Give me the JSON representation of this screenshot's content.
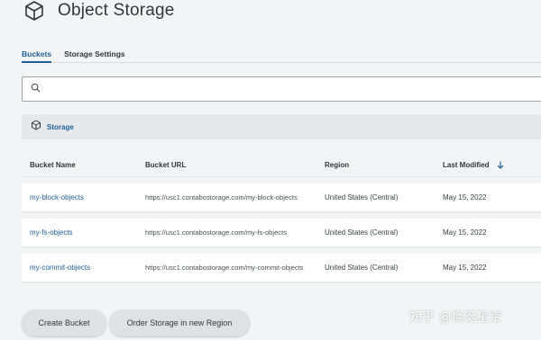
{
  "header": {
    "title": "Object Storage",
    "icon": "cube-icon"
  },
  "tabs": [
    {
      "label": "Buckets",
      "active": true
    },
    {
      "label": "Storage Settings",
      "active": false
    }
  ],
  "search": {
    "placeholder": "",
    "value": ""
  },
  "group": {
    "label": "Storage",
    "icon": "cube-icon"
  },
  "table": {
    "columns": [
      "Bucket Name",
      "Bucket URL",
      "Region",
      "Last Modified"
    ],
    "sort_column": "Last Modified",
    "sort_direction": "descending",
    "rows": [
      {
        "name": "my-block-objects",
        "url": "https://usc1.contabostorage.com/my-block-objects",
        "region": "United States (Central)",
        "modified": "May 15, 2022"
      },
      {
        "name": "my-fs-objects",
        "url": "https://usc1.contabostorage.com/my-fs-objects",
        "region": "United States (Central)",
        "modified": "May 15, 2022"
      },
      {
        "name": "my-commit-objects",
        "url": "https://usc1.contabostorage.com/my-commit-objects",
        "region": "United States (Central)",
        "modified": "May 15, 2022"
      }
    ]
  },
  "buttons": {
    "create": "Create Bucket",
    "order": "Order Storage in new Region"
  },
  "watermark": "知乎 @怪诞星空",
  "colors": {
    "accent": "#1f5f9a",
    "background": "#f3f4f6",
    "group_bg": "#e7e8ea",
    "button_bg": "#e0e1e3"
  }
}
